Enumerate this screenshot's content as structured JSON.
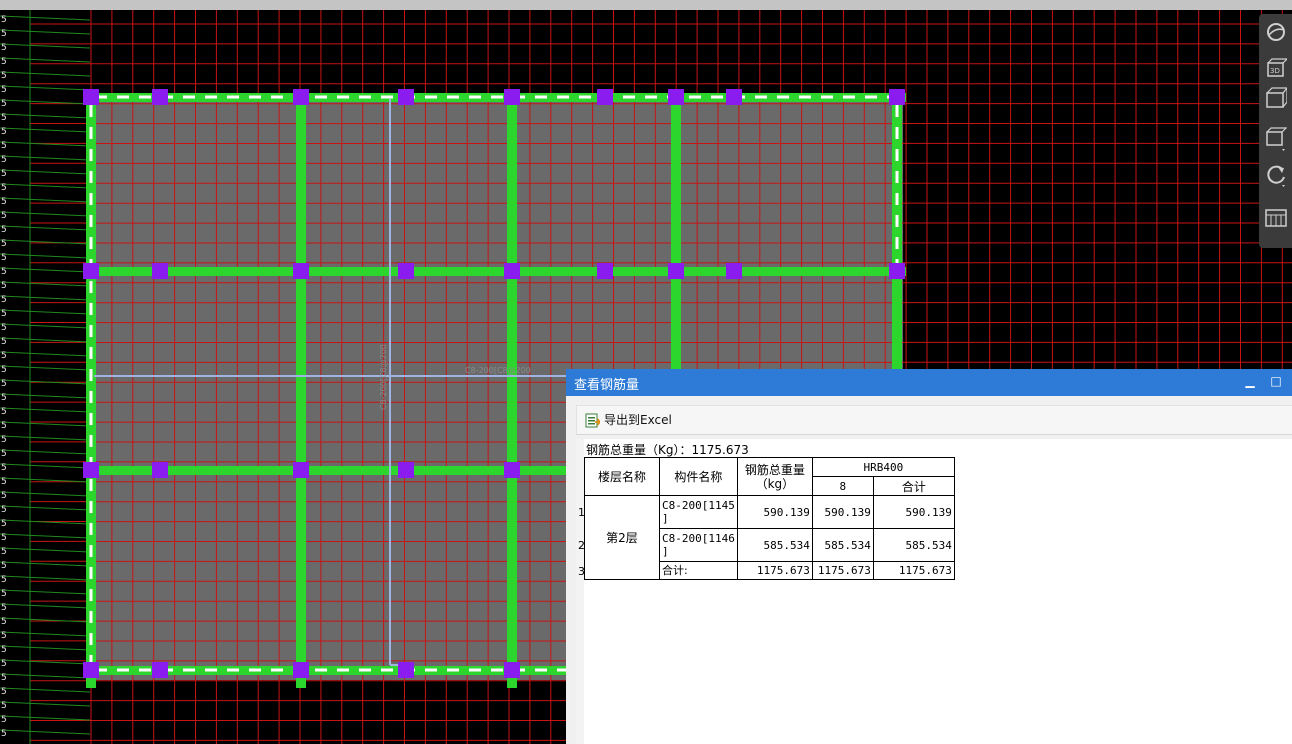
{
  "cad": {
    "dimension_text_vertical": "C8-200[C8@200",
    "dimension_text_horizontal": "C8-200[C8@200",
    "left_axis_glyph": "5"
  },
  "view_toolbar": {
    "buttons": [
      {
        "name": "orbit-icon",
        "label": ""
      },
      {
        "name": "3d-view-icon",
        "label": "3D"
      },
      {
        "name": "box-view-icon",
        "label": ""
      },
      {
        "name": "cube-dropdown-icon",
        "label": ""
      },
      {
        "name": "rotate-icon",
        "label": ""
      },
      {
        "name": "layer-panel-icon",
        "label": ""
      }
    ]
  },
  "rebar_window": {
    "title": "查看钢筋量",
    "minimize_glyph": "▁",
    "maximize_glyph": "□",
    "export_label": "导出到Excel",
    "total_weight": "钢筋总重量（Kg）：1175.673",
    "headers": {
      "floor": "楼层名称",
      "component": "构件名称",
      "total_weight": "钢筋总重量\n（kg）",
      "grade": "HRB400",
      "diameter": "8",
      "subtotal": "合计"
    },
    "row_numbers": [
      "1",
      "2",
      "3"
    ],
    "floor_name": "第2层",
    "rows": [
      {
        "component": "C8-200[1145\n]",
        "total": "590.139",
        "d8": "590.139",
        "sum": "590.139"
      },
      {
        "component": "C8-200[1146\n]",
        "total": "585.534",
        "d8": "585.534",
        "sum": "585.534"
      },
      {
        "component": "合计:",
        "total": "1175.673",
        "d8": "1175.673",
        "sum": "1175.673"
      }
    ]
  },
  "colors": {
    "grid": "#c81414",
    "beam": "#2cd62c",
    "column": "#8a1cf0",
    "slab": "#6a6a6a",
    "rebar_line": "#9fb4e0",
    "titlebar": "#2d7bd6"
  }
}
